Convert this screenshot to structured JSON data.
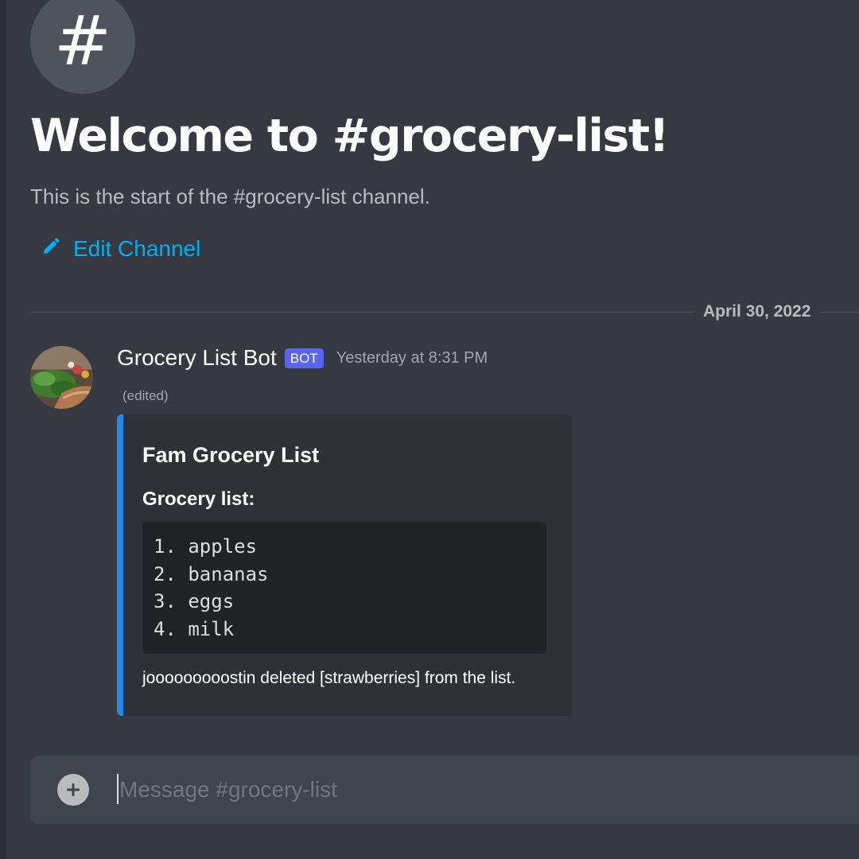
{
  "channel": {
    "hash_symbol": "#",
    "welcome_title": "Welcome to #grocery-list!",
    "welcome_subtitle": "This is the start of the #grocery-list channel.",
    "edit_label": "Edit Channel"
  },
  "divider": {
    "date": "April 30, 2022"
  },
  "message": {
    "author": "Grocery List Bot",
    "bot_tag": "BOT",
    "timestamp": "Yesterday at 8:31 PM",
    "edited": "(edited)",
    "avatar_icon": "grocery-produce-avatar",
    "embed": {
      "accent_color": "#1f8ceb",
      "title": "Fam Grocery List",
      "field_name": "Grocery list:",
      "code_lines": [
        "1. apples",
        "2. bananas",
        "3. eggs",
        "4. milk"
      ],
      "footer": "jooooooooostin deleted [strawberries] from the list."
    }
  },
  "composer": {
    "placeholder": "Message #grocery-list",
    "value": "",
    "add_icon": "plus-circle-icon"
  },
  "colors": {
    "background": "#36393f",
    "link": "#00aff4",
    "bot_tag": "#5865f2"
  }
}
